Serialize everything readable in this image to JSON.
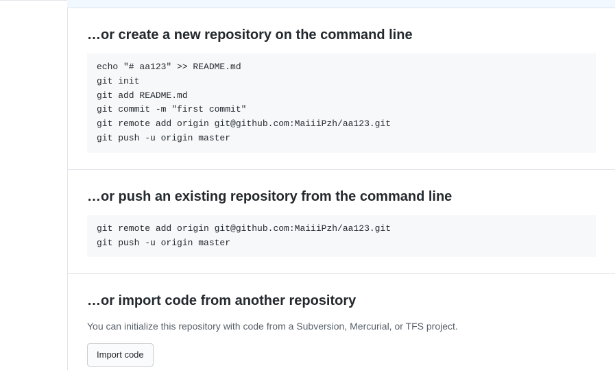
{
  "sections": {
    "create_repo": {
      "heading": "…or create a new repository on the command line",
      "code": "echo \"# aa123\" >> README.md\ngit init\ngit add README.md\ngit commit -m \"first commit\"\ngit remote add origin git@github.com:MaiiiPzh/aa123.git\ngit push -u origin master"
    },
    "push_existing": {
      "heading": "…or push an existing repository from the command line",
      "code": "git remote add origin git@github.com:MaiiiPzh/aa123.git\ngit push -u origin master"
    },
    "import_code": {
      "heading": "…or import code from another repository",
      "description": "You can initialize this repository with code from a Subversion, Mercurial, or TFS project.",
      "button_label": "Import code"
    }
  }
}
